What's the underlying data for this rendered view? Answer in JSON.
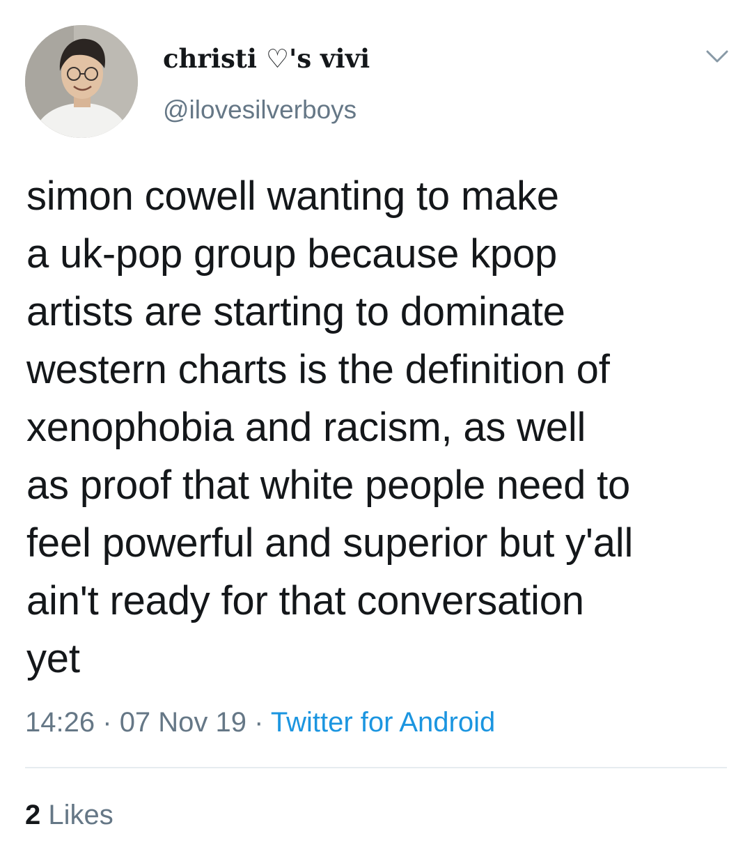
{
  "tweet": {
    "author": {
      "display_name": "christi ♡'s vivi",
      "handle": "@ilovesilverboys",
      "avatar": "profile-photo"
    },
    "menu_icon": "chevron-down-icon",
    "text": "simon cowell wanting to make\na uk-pop group because kpop\nartists are starting to dominate\nwestern charts is the definition of\nxenophobia and racism, as well\nas proof that white people need to\nfeel powerful and superior but y'all\nain't ready for that conversation\nyet",
    "time": "14:26",
    "separator": "·",
    "date": "07 Nov 19",
    "source": "Twitter for Android",
    "likes": {
      "count": "2",
      "label": "Likes"
    }
  },
  "colors": {
    "text": "#14171a",
    "secondary": "#657786",
    "link": "#1b95e0",
    "divider": "#e6ecf0"
  }
}
